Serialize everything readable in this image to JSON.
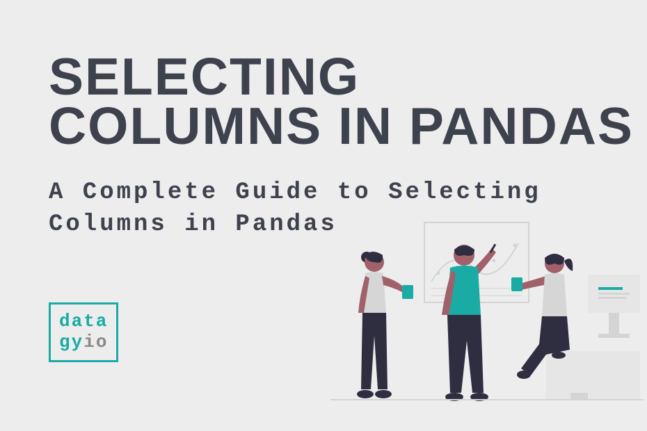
{
  "title": "SELECTING COLUMNS IN PANDAS",
  "subtitle": "A Complete Guide to Selecting Columns in Pandas",
  "logo": {
    "line1_teal": "data",
    "line2_teal": "gy",
    "line2_gray": "io"
  },
  "colors": {
    "background": "#eeedee",
    "text_dark": "#3d424d",
    "teal": "#1aaba5",
    "gray": "#8a8a8a",
    "illustration_dark": "#2f2e41",
    "illustration_skin": "#a0616a",
    "illustration_light": "#e6e6e6"
  }
}
